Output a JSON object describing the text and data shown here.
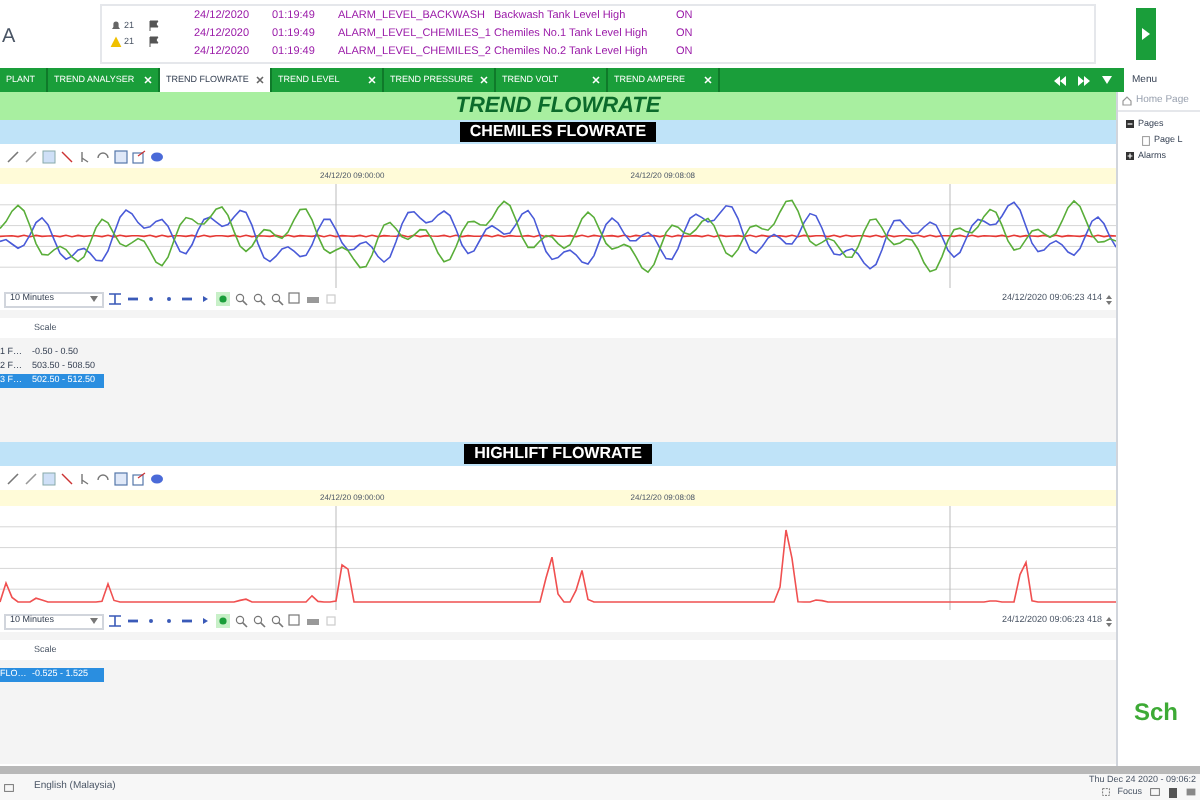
{
  "header": {
    "logo_text": "A",
    "alarm_counts": [
      "21",
      "21"
    ],
    "alarms": [
      {
        "date": "24/12/2020",
        "time": "01:19:49",
        "tag": "ALARM_LEVEL_BACKWASH",
        "description": "Backwash Tank Level High",
        "state": "ON"
      },
      {
        "date": "24/12/2020",
        "time": "01:19:49",
        "tag": "ALARM_LEVEL_CHEMILES_1",
        "description": "Chemiles No.1 Tank Level High",
        "state": "ON"
      },
      {
        "date": "24/12/2020",
        "time": "01:19:49",
        "tag": "ALARM_LEVEL_CHEMILES_2",
        "description": "Chemiles No.2 Tank Level High",
        "state": "ON"
      }
    ]
  },
  "tabs": [
    {
      "label": "PLANT",
      "selected": false
    },
    {
      "label": "TREND ANALYSER",
      "selected": false
    },
    {
      "label": "TREND FLOWRATE",
      "selected": true
    },
    {
      "label": "TREND LEVEL",
      "selected": false
    },
    {
      "label": "TREND PRESSURE",
      "selected": false
    },
    {
      "label": "TREND VOLT",
      "selected": false
    },
    {
      "label": "TREND AMPERE",
      "selected": false
    }
  ],
  "menu": {
    "placeholder": "Menu"
  },
  "page_title": "TREND FLOWRATE",
  "trends": [
    {
      "title": "CHEMILES FLOWRATE",
      "times": [
        "24/12/20 09:00:00",
        "24/12/20 09:08:08"
      ],
      "range": "10 Minutes",
      "cursor_time": "24/12/2020 09:06:23 414",
      "scale_heading": "Scale",
      "pens": [
        {
          "name": "1 F…",
          "scale": "-0.50 - 0.50",
          "selected": false,
          "color": "#e53935"
        },
        {
          "name": "2 F…",
          "scale": "503.50 - 508.50",
          "selected": false,
          "color": "#4a5bd8"
        },
        {
          "name": "3 F…",
          "scale": "502.50 - 512.50",
          "selected": true,
          "color": "#5aae3a"
        }
      ]
    },
    {
      "title": "HIGHLIFT FLOWRATE",
      "times": [
        "24/12/20 09:00:00",
        "24/12/20 09:08:08"
      ],
      "range": "10 Minutes",
      "cursor_time": "24/12/2020 09:06:23 418",
      "scale_heading": "Scale",
      "pens": [
        {
          "name": "FLO…",
          "scale": "-0.525 - 1.525",
          "selected": true,
          "color": "#f05050"
        }
      ]
    }
  ],
  "sidebar": {
    "home": "Home Page",
    "tree": [
      {
        "label": "Pages",
        "expanded": true,
        "children": [
          {
            "label": "Page L"
          }
        ]
      },
      {
        "label": "Alarms",
        "expanded": false
      }
    ],
    "logo_text": "Sch"
  },
  "status_bar": {
    "language": "English (Malaysia)",
    "datetime": "Thu Dec 24 2020 - 09:06:2",
    "focus": "Focus"
  }
}
